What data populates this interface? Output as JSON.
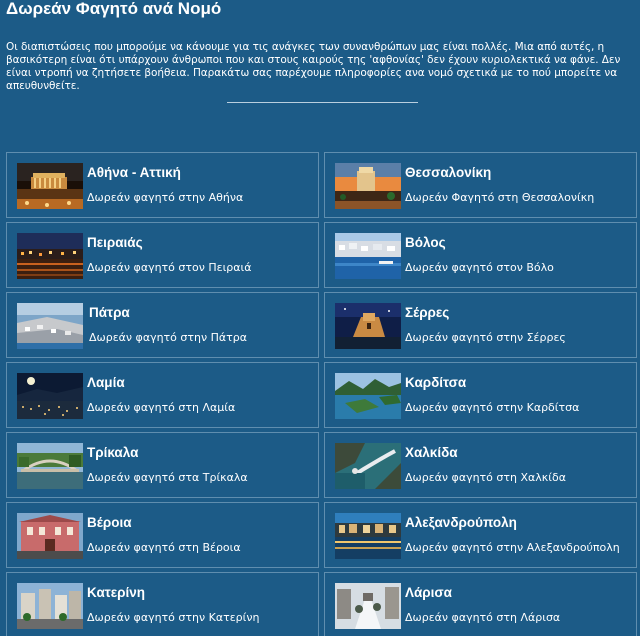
{
  "page": {
    "title": "Δωρεάν Φαγητό ανά Νομό",
    "intro": "Οι διαπιστώσεις που μπορούμε να κάνουμε για τις ανάγκες των συνανθρώπων μας είναι πολλές. Μια από αυτές, η βασικότερη είναι ότι υπάρχουν άνθρωποι που και στους καιρούς της 'αφθονίας' δεν έχουν κυριολεκτικά να φάνε. Δεν είναι ντροπή να ζητήσετε βοήθεια. Παρακάτω σας παρέχουμε πληροφορίες ανα νομό σχετικά με το πού μπορείτε να απευθυνθείτε."
  },
  "cities": [
    {
      "name": "Αθήνα - Αττική",
      "desc": "Δωρεάν φαγητό στην Αθήνα",
      "icon": "athens-acropolis-photo"
    },
    {
      "name": "Θεσσαλονίκη",
      "desc": "Δωρεάν Φαγητό στη Θεσσαλονίκη",
      "icon": "thessaloniki-white-tower-photo"
    },
    {
      "name": "Πειραιάς",
      "desc": "Δωρεάν φαγητό στον Πειραιά",
      "icon": "piraeus-harbor-night-photo"
    },
    {
      "name": "Βόλος",
      "desc": "Δωρεάν φαγητό στον Βόλο",
      "icon": "volos-city-coast-photo"
    },
    {
      "name": "Πάτρα",
      "desc": "Δωρεάν φαγητό στην Πάτρα",
      "icon": "patra-aerial-photo"
    },
    {
      "name": "Σέρρες",
      "desc": "Δωρεάν φαγητό στην Σέρρες",
      "icon": "serres-fortress-photo"
    },
    {
      "name": "Λαμία",
      "desc": "Δωρεάν φαγητό στη Λαμία",
      "icon": "lamia-night-photo"
    },
    {
      "name": "Καρδίτσα",
      "desc": "Δωρεάν φαγητό στην Καρδίτσα",
      "icon": "karditsa-lake-photo"
    },
    {
      "name": "Τρίκαλα",
      "desc": "Δωρεάν φαγητό στα Τρίκαλα",
      "icon": "trikala-bridge-photo"
    },
    {
      "name": "Χαλκίδα",
      "desc": "Δωρεάν φαγητό στη Χαλκίδα",
      "icon": "chalkida-bridge-photo"
    },
    {
      "name": "Βέροια",
      "desc": "Δωρεάν φαγητό στη Βέροια",
      "icon": "veria-building-photo"
    },
    {
      "name": "Αλεξανδρούπολη",
      "desc": "Δωρεάν φαγητό στην Αλεξανδρούπολη",
      "icon": "alexandroupoli-waterfront-photo"
    },
    {
      "name": "Κατερίνη",
      "desc": "Δωρεάν φαγητό στην Κατερίνη",
      "icon": "katerini-street-photo"
    },
    {
      "name": "Λάρισα",
      "desc": "Δωρεάν φαγητό στη Λάρισα",
      "icon": "larisa-snow-street-photo"
    }
  ],
  "colors": {
    "background": "#1c5b87",
    "card_border": "#5f8eaf",
    "text": "#ffffff"
  }
}
